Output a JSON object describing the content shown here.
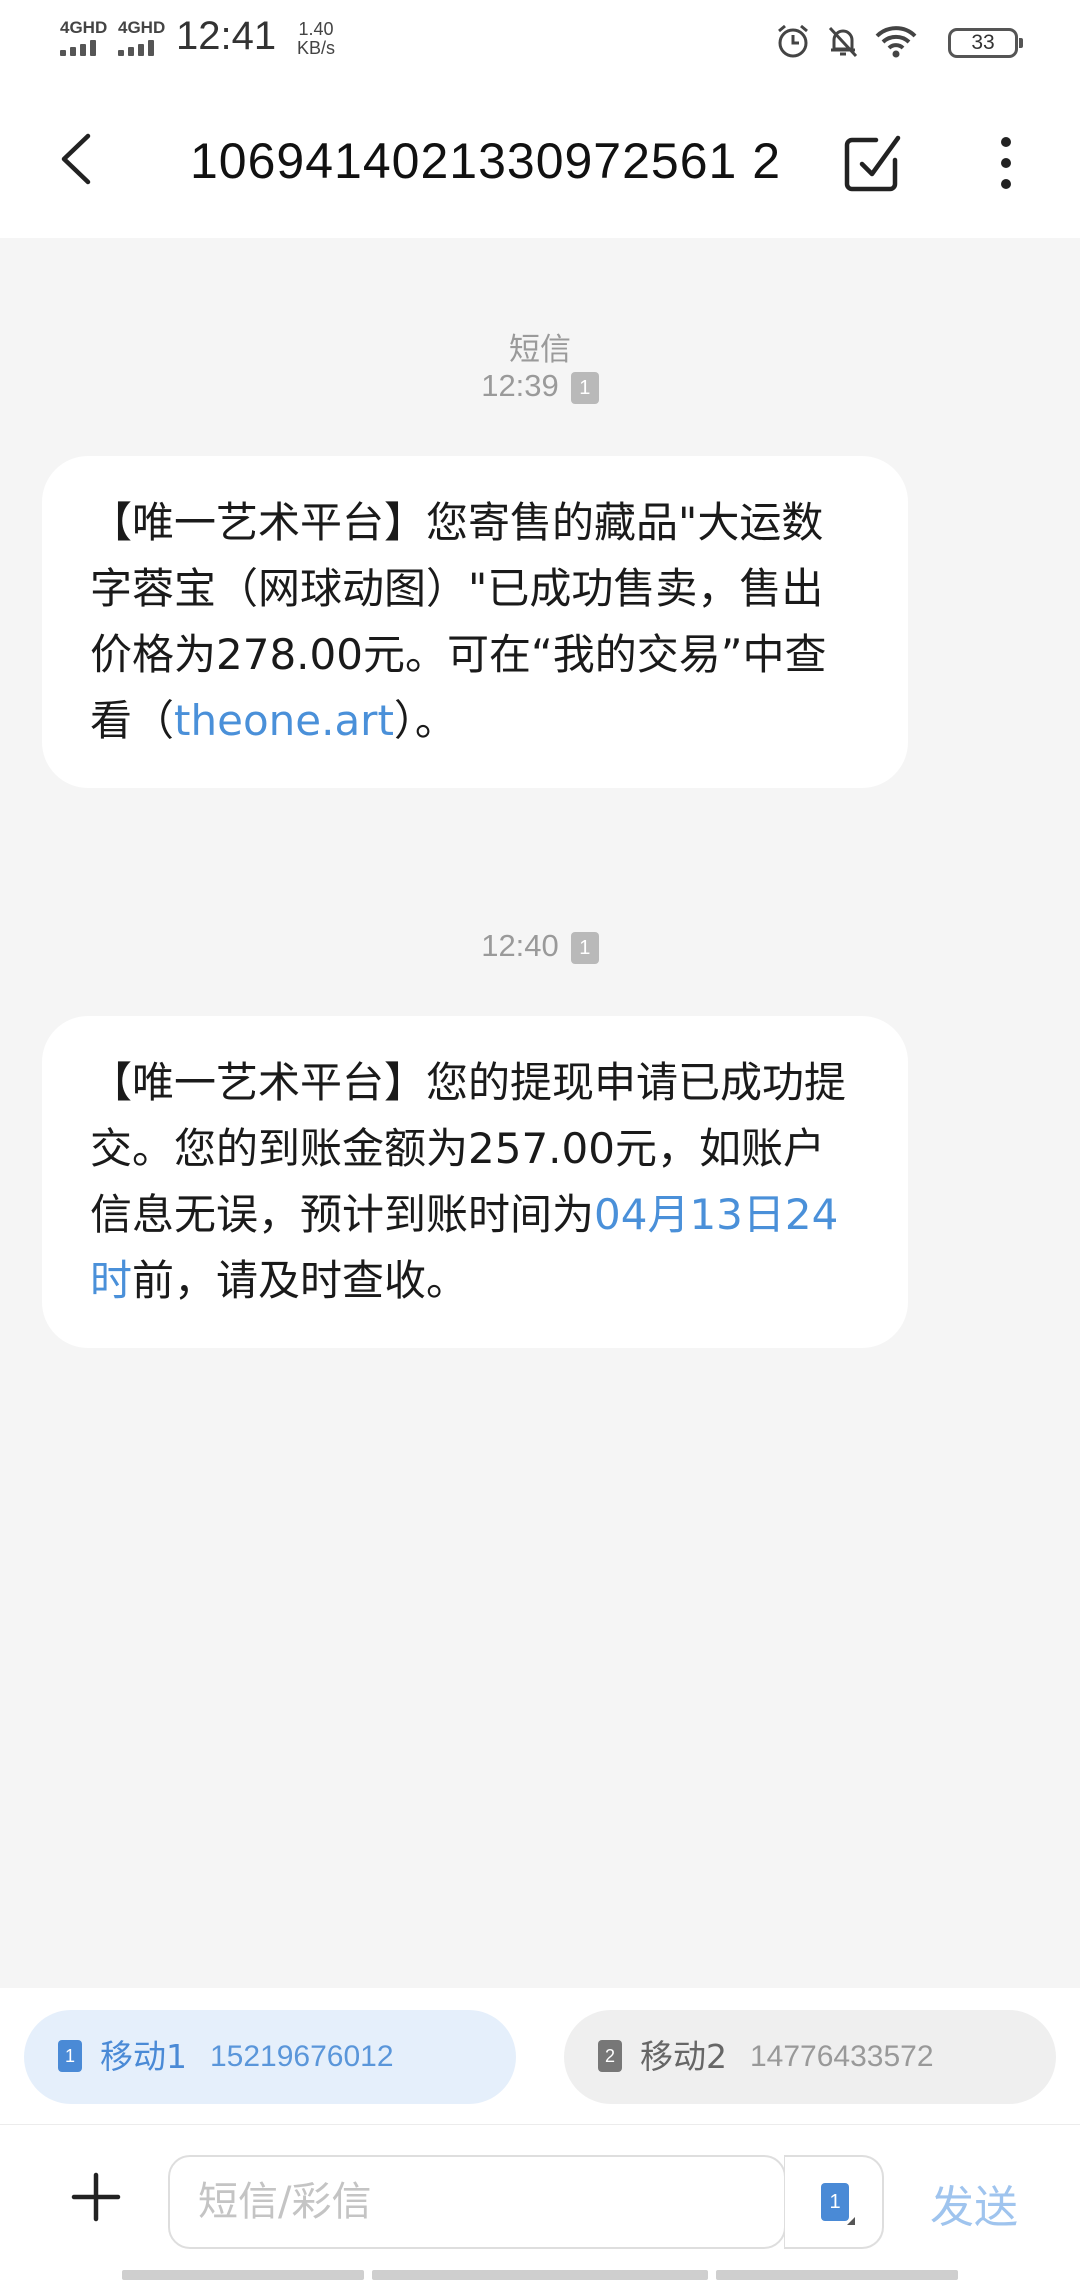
{
  "status_bar": {
    "signal1": "4GHD",
    "signal2": "4GHD",
    "time": "12:41",
    "net_speed_value": "1.40",
    "net_speed_unit": "KB/s",
    "battery": "33"
  },
  "header": {
    "title": "1069414021330972561 2"
  },
  "conversation": {
    "type_label": "短信",
    "messages": [
      {
        "time": "12:39",
        "sim": "1",
        "text_before_link": "【唯一艺术平台】您寄售的藏品\"大运数字蓉宝（网球动图）\"已成功售卖，售出价格为278.00元。可在“我的交易”中查看（",
        "link": "theone.art",
        "text_after_link": "）。"
      },
      {
        "time": "12:40",
        "sim": "1",
        "text_before_link": "【唯一艺术平台】您的提现申请已成功提交。您的到账金额为257.00元，如账户信息无误，预计到账时间为",
        "link": "04月13日24时",
        "text_after_link": "前，请及时查收。"
      }
    ]
  },
  "sim_selector": {
    "sim1": {
      "index": "1",
      "name": "移动1",
      "number": "15219676012"
    },
    "sim2": {
      "index": "2",
      "name": "移动2",
      "number": "14776433572"
    }
  },
  "compose": {
    "placeholder": "短信/彩信",
    "value": "",
    "sim": "1",
    "send_label": "发送"
  },
  "colors": {
    "accent": "#4a90d9",
    "background": "#f5f5f5",
    "bubble": "#ffffff",
    "send_disabled": "#9fc4ee"
  },
  "icons": {
    "back": "chevron-left-icon",
    "edit": "edit-square-icon",
    "more": "more-vertical-icon",
    "add": "plus-icon",
    "alarm": "alarm-icon",
    "mute": "bell-off-icon",
    "wifi": "wifi-icon"
  }
}
